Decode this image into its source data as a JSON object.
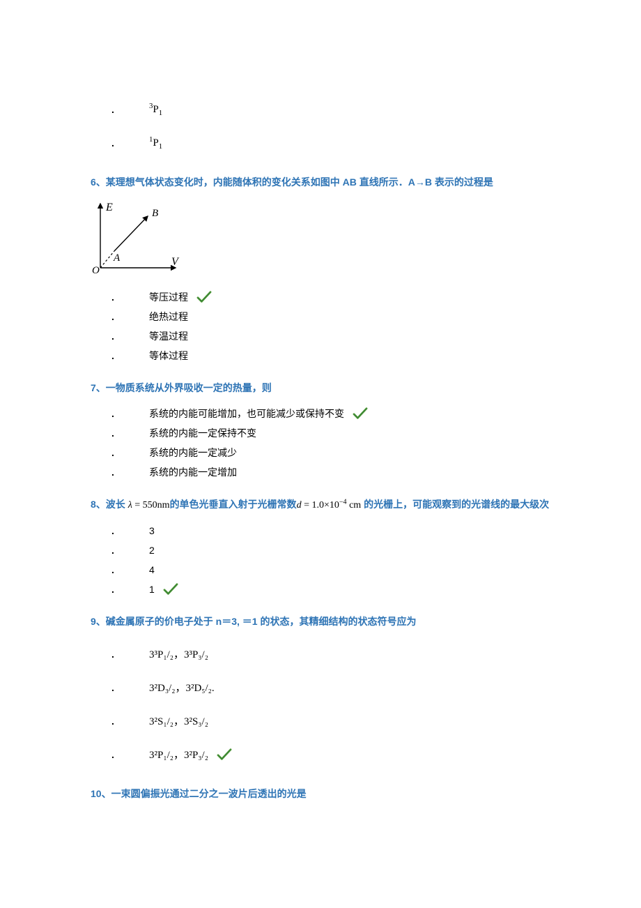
{
  "top_options": [
    {
      "label": "³P₁"
    },
    {
      "label": "¹P₁"
    }
  ],
  "q6": {
    "title": "6、某理想气体状态变化时，内能随体积的变化关系如图中 AB 直线所示．A→B 表示的过程是",
    "options": [
      {
        "text": "等压过程",
        "correct": true
      },
      {
        "text": "绝热过程",
        "correct": false
      },
      {
        "text": "等温过程",
        "correct": false
      },
      {
        "text": "等体过程",
        "correct": false
      }
    ],
    "diagram": {
      "x_axis": "V",
      "y_axis": "E",
      "points": [
        "A",
        "B"
      ]
    }
  },
  "q7": {
    "title": "7、一物质系统从外界吸收一定的热量，则",
    "options": [
      {
        "text": "系统的内能可能增加，也可能减少或保持不变",
        "correct": true
      },
      {
        "text": "系统的内能一定保持不变",
        "correct": false
      },
      {
        "text": "系统的内能一定减少",
        "correct": false
      },
      {
        "text": "系统的内能一定增加",
        "correct": false
      }
    ]
  },
  "q8": {
    "title_parts": {
      "p1": "8、波长 ",
      "lambda": "λ = 550nm",
      "p2": "的单色光垂直入射于光栅常数",
      "d": "d = 1.0×10⁻⁴ cm",
      "p3": " 的光栅上，可能观察到的光谱线的最大级次"
    },
    "options": [
      {
        "text": "3",
        "correct": false
      },
      {
        "text": "2",
        "correct": false
      },
      {
        "text": "4",
        "correct": false
      },
      {
        "text": "1",
        "correct": true
      }
    ]
  },
  "q9": {
    "title": "9、碱金属原子的价电子处于 n＝3,  ＝1 的状态，其精细结构的状态符号应为",
    "options": [
      {
        "text": "3³P₁/₂，3³P₃/₂",
        "correct": false
      },
      {
        "text": "3²D₃/₂，3²D₅/₂.",
        "correct": false
      },
      {
        "text": "3²S₁/₂，3²S₃/₂",
        "correct": false
      },
      {
        "text": "3²P₁/₂，3²P₃/₂",
        "correct": true
      }
    ]
  },
  "q10": {
    "title": "10、一束圆偏振光通过二分之一波片后透出的光是"
  }
}
